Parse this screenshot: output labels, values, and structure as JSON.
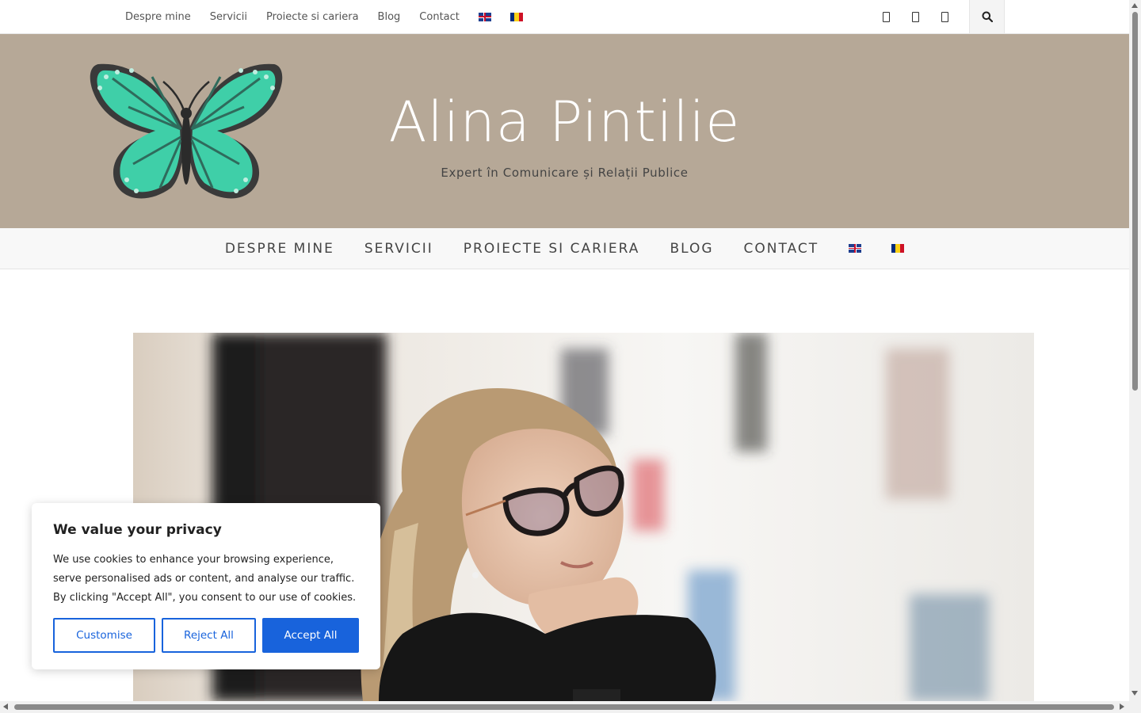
{
  "topbar": {
    "nav": [
      "Despre mine",
      "Servicii",
      "Proiecte si cariera",
      "Blog",
      "Contact"
    ],
    "flags": [
      "uk-flag-icon",
      "ro-flag-icon"
    ],
    "social_icons": [
      "social-icon-1",
      "social-icon-2",
      "social-icon-3"
    ],
    "search_icon": "search-icon"
  },
  "header": {
    "logo_icon": "butterfly-logo",
    "title": "Alina Pintilie",
    "tagline": "Expert în Comunicare și Relații Publice",
    "background": "#b6a897"
  },
  "mainnav": {
    "items": [
      "DESPRE MINE",
      "SERVICII",
      "PROIECTE SI CARIERA",
      "BLOG",
      "CONTACT"
    ]
  },
  "hero": {
    "image": "portrait-photo"
  },
  "cookie": {
    "title": "We value your privacy",
    "text": "We use cookies to enhance your browsing experience, serve personalised ads or content, and analyse our traffic. By clicking \"Accept All\", you consent to our use of cookies.",
    "customise": "Customise",
    "reject": "Reject All",
    "accept": "Accept All",
    "accent": "#1863dc"
  }
}
